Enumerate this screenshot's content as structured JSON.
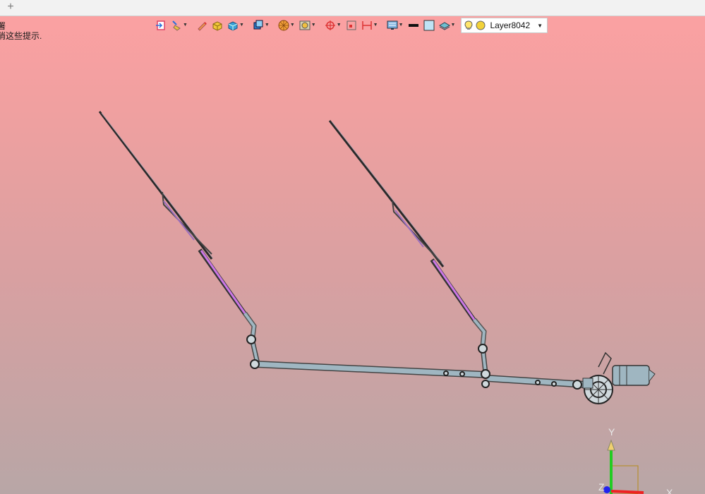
{
  "tabbar": {
    "new_tab": "+"
  },
  "hint": {
    "line1": "署",
    "line2": "消这些提示."
  },
  "toolbar": {
    "items": [
      {
        "name": "exit-icon",
        "dropdown": false
      },
      {
        "name": "paint-brush-icon",
        "dropdown": true
      },
      {
        "name": "pencil-icon",
        "dropdown": false
      },
      {
        "name": "box-yellow-icon",
        "dropdown": false
      },
      {
        "name": "box-blue-icon",
        "dropdown": true
      },
      {
        "name": "view-cube-icon",
        "dropdown": true
      },
      {
        "name": "pie-wheel-icon",
        "dropdown": true
      },
      {
        "name": "frame-icon",
        "dropdown": true
      },
      {
        "name": "crosshair-icon",
        "dropdown": true
      },
      {
        "name": "small-square-icon",
        "dropdown": false
      },
      {
        "name": "dimension-icon",
        "dropdown": true
      },
      {
        "name": "monitor-icon",
        "dropdown": true
      },
      {
        "name": "black-bar-icon",
        "dropdown": false
      },
      {
        "name": "light-blue-square-icon",
        "dropdown": false
      },
      {
        "name": "layers-icon",
        "dropdown": true
      }
    ],
    "layer": {
      "label": "Layer8042"
    }
  },
  "axes": {
    "x": "X",
    "y": "Y",
    "z": "Z"
  },
  "colors": {
    "bg_top": "#fda1a2",
    "bg_bottom": "#b8a6a6",
    "link_body": "#9fb6c1",
    "blade_highlight": "#cc77e6",
    "axis_y": "#22cc22",
    "axis_x": "#ee2222",
    "axis_z": "#2222ee"
  }
}
